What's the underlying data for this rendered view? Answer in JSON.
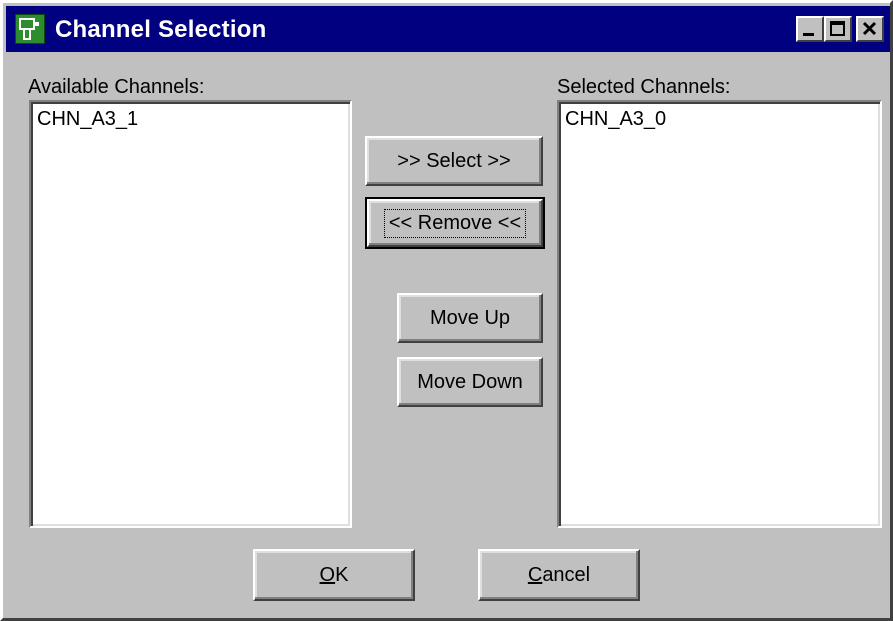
{
  "window": {
    "title": "Channel Selection",
    "icon": "app-icon"
  },
  "title_buttons": {
    "minimize": "minimize-icon",
    "maximize": "maximize-icon",
    "close": "close-icon"
  },
  "available": {
    "label": "Available Channels:",
    "items": [
      "CHN_A3_1"
    ]
  },
  "selected": {
    "label": "Selected Channels:",
    "items": [
      "CHN_A3_0"
    ]
  },
  "buttons": {
    "select": ">> Select >>",
    "remove": "<< Remove <<",
    "move_up": "Move Up",
    "move_down": "Move Down",
    "ok": "OK",
    "cancel": "Cancel"
  }
}
